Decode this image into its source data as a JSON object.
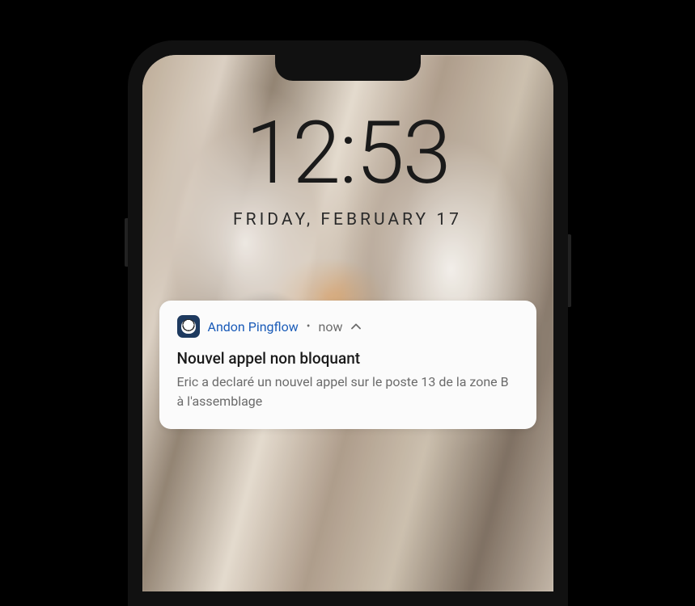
{
  "lockscreen": {
    "time": "12:53",
    "date": "Friday, February 17"
  },
  "notification": {
    "app_name": "Andon Pingflow",
    "timestamp": "now",
    "title": "Nouvel appel non bloquant",
    "body": "Eric a declaré un nouvel appel sur le poste 13 de la zone B à l'assemblage"
  }
}
